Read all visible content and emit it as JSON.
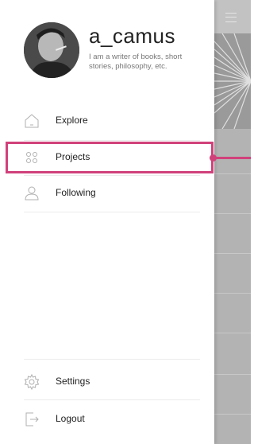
{
  "profile": {
    "username": "a_camus",
    "bio": "I am a writer of books, short stories, philosophy, etc."
  },
  "menu": {
    "main": [
      {
        "label": "Explore",
        "icon": "home-icon"
      },
      {
        "label": "Projects",
        "icon": "grid-icon"
      },
      {
        "label": "Following",
        "icon": "person-icon"
      }
    ],
    "bottom": [
      {
        "label": "Settings",
        "icon": "gear-icon"
      },
      {
        "label": "Logout",
        "icon": "logout-icon"
      }
    ]
  },
  "highlight": {
    "item": "Projects",
    "color": "#d0417a"
  }
}
